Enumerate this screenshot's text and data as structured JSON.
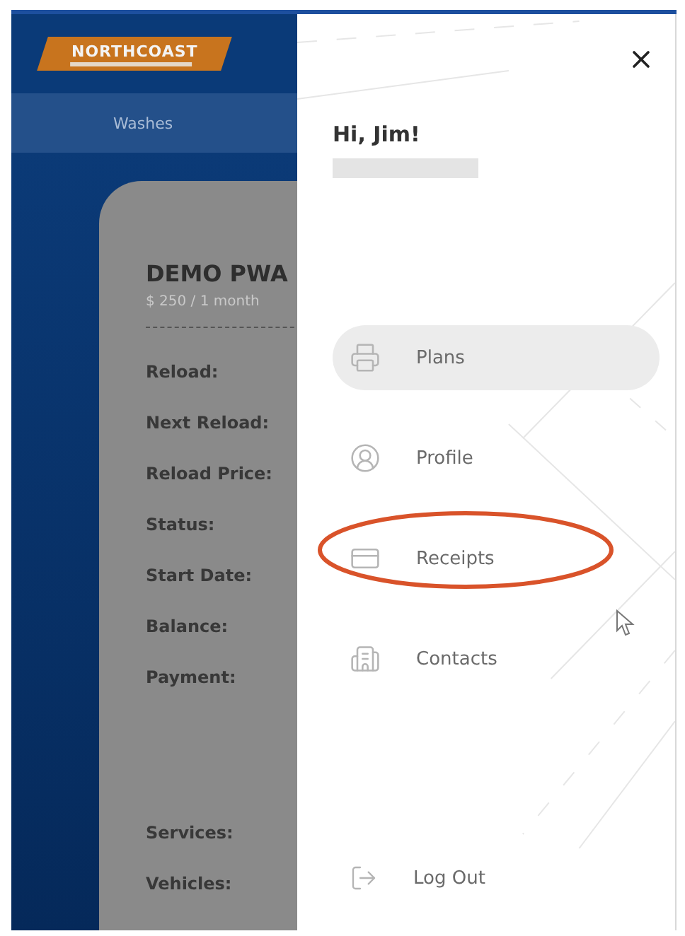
{
  "app": {
    "logo": "NORTHCOAST",
    "nav": [
      {
        "label": "Washes",
        "selected": true
      }
    ],
    "card": {
      "title": "DEMO PWA",
      "subtitle": "$ 250 / 1 month",
      "fields": [
        {
          "label": "Reload:",
          "gap_after": false
        },
        {
          "label": "Next Reload:",
          "gap_after": false
        },
        {
          "label": "Reload Price:",
          "gap_after": false
        },
        {
          "label": "Status:",
          "gap_after": false
        },
        {
          "label": "Start Date:",
          "gap_after": false
        },
        {
          "label": "Balance:",
          "gap_after": false
        },
        {
          "label": "Payment:",
          "gap_after": true
        },
        {
          "label": "Services:",
          "gap_after": false
        },
        {
          "label": "Vehicles:",
          "gap_after": false
        }
      ]
    }
  },
  "drawer": {
    "greeting": "Hi, Jim!",
    "menu": {
      "items": [
        {
          "label": "Plans",
          "selected": true,
          "highlighted": false
        },
        {
          "label": "Profile",
          "selected": false,
          "highlighted": false
        },
        {
          "label": "Receipts",
          "selected": false,
          "highlighted": true
        },
        {
          "label": "Contacts",
          "selected": false,
          "highlighted": false
        }
      ]
    },
    "logout": {
      "label": "Log Out"
    }
  }
}
